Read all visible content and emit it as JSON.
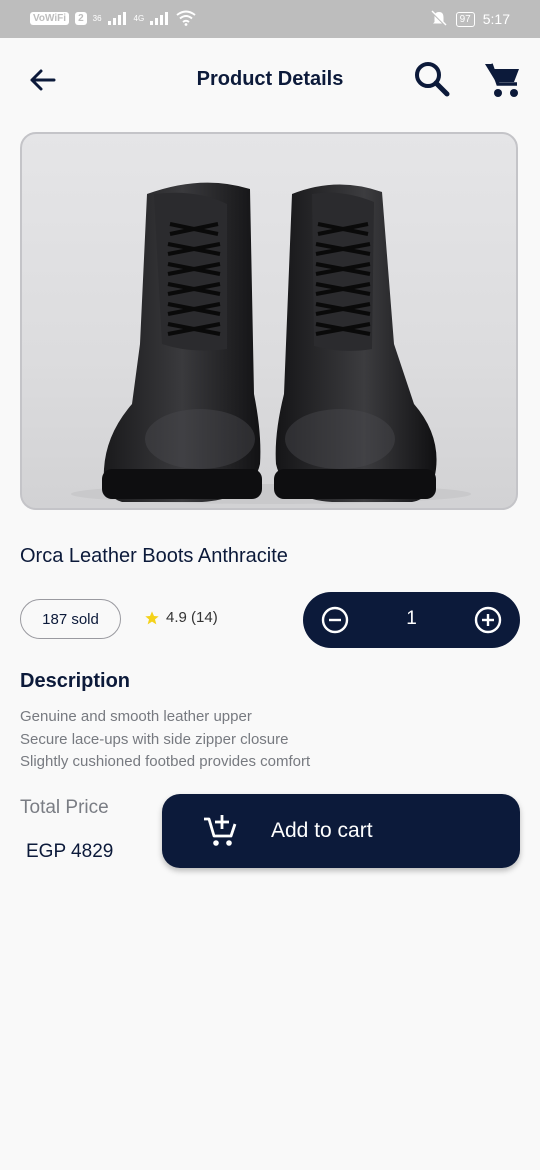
{
  "status_bar": {
    "left_chips": [
      "VoWiFi",
      "2"
    ],
    "net1": "36",
    "net2": "4G",
    "battery": "97",
    "time": "5:17"
  },
  "appbar": {
    "title": "Product Details",
    "back_icon": "arrow-left-icon",
    "search_icon": "search-icon",
    "cart_icon": "cart-icon"
  },
  "product": {
    "name": "Orca Leather Boots Anthracite",
    "sold": "187 sold",
    "rating": "4.9 (14)",
    "quantity": "1",
    "description_title": "Description",
    "description_lines": [
      "Genuine and smooth leather upper",
      "Secure lace-ups with side zipper closure",
      "Slightly cushioned footbed provides comfort"
    ],
    "total_price_label": "Total Price",
    "price": "EGP 4829",
    "add_to_cart_label": "Add to cart"
  },
  "colors": {
    "primary": "#0c1a3a",
    "star": "#f4d21a",
    "background": "#f9f9f9"
  }
}
